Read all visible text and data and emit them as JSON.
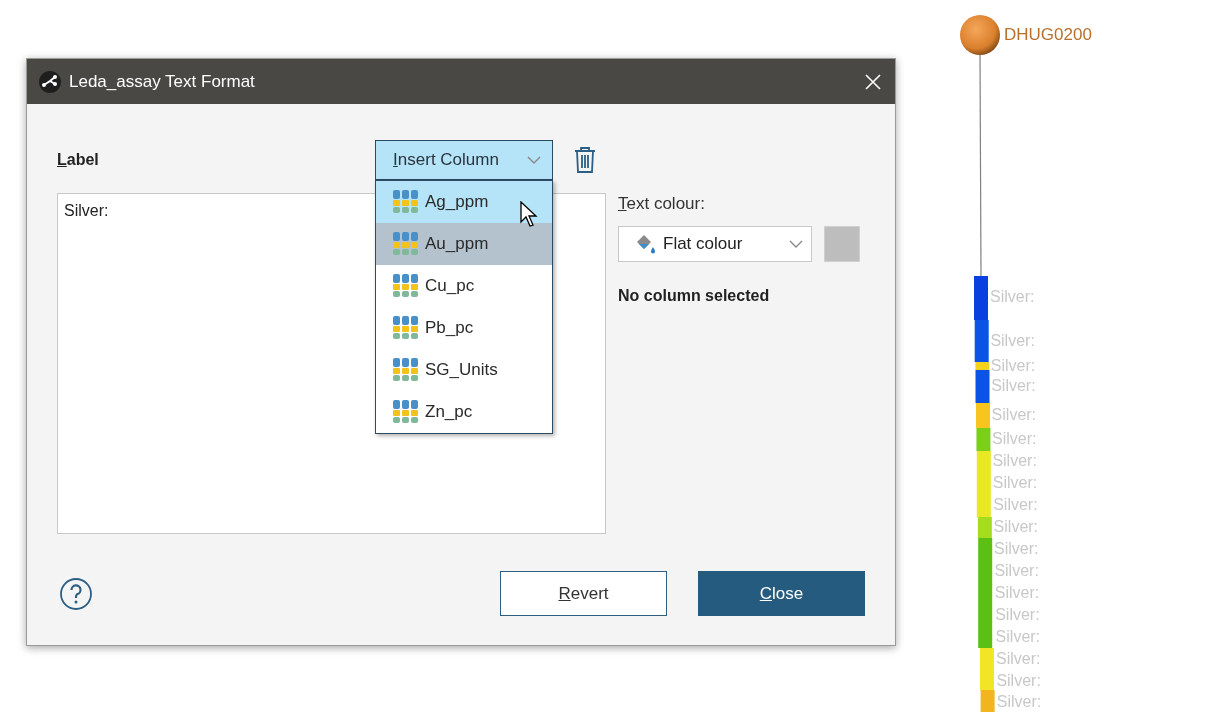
{
  "dialog": {
    "title": "Leda_assay Text Format",
    "label_heading": "Label",
    "insert_column": {
      "label": "Insert Column",
      "expanded": true
    },
    "label_text": "Silver:",
    "column_options": [
      {
        "name": "Ag_ppm",
        "hovered": true,
        "selected": false
      },
      {
        "name": "Au_ppm",
        "hovered": false,
        "selected": true
      },
      {
        "name": "Cu_pc",
        "hovered": false,
        "selected": false
      },
      {
        "name": "Pb_pc",
        "hovered": false,
        "selected": false
      },
      {
        "name": "SG_Units",
        "hovered": false,
        "selected": false
      },
      {
        "name": "Zn_pc",
        "hovered": false,
        "selected": false
      }
    ],
    "text_colour": {
      "heading": "Text colour:",
      "mode": "Flat colour"
    },
    "status": "No column selected",
    "buttons": [
      {
        "label": "Revert",
        "kind": "secondary"
      },
      {
        "label": "Close",
        "kind": "primary"
      }
    ]
  },
  "scene": {
    "hole_id": "DHUG0200",
    "segments": [
      {
        "color": "#0a3fe0"
      },
      {
        "color": "#0b52e6"
      },
      {
        "color": "#f5d21c"
      },
      {
        "color": "#0b52e6"
      },
      {
        "color": "#f7c51e"
      },
      {
        "color": "#7ccf18"
      },
      {
        "color": "#e8e824"
      },
      {
        "color": "#a6dc20"
      },
      {
        "color": "#5cc014"
      },
      {
        "color": "#f2e526"
      },
      {
        "color": "#f2b51e"
      }
    ],
    "labels": [
      "Silver:",
      "Silver:",
      "Silver:",
      "Silver:",
      "Silver:",
      "Silver:",
      "Silver:",
      "Silver:",
      "Silver:",
      "Silver:",
      "Silver:",
      "Silver:",
      "Silver:",
      "Silver:",
      "Silver:",
      "Silver:",
      "Silver:",
      "Silver:"
    ]
  }
}
